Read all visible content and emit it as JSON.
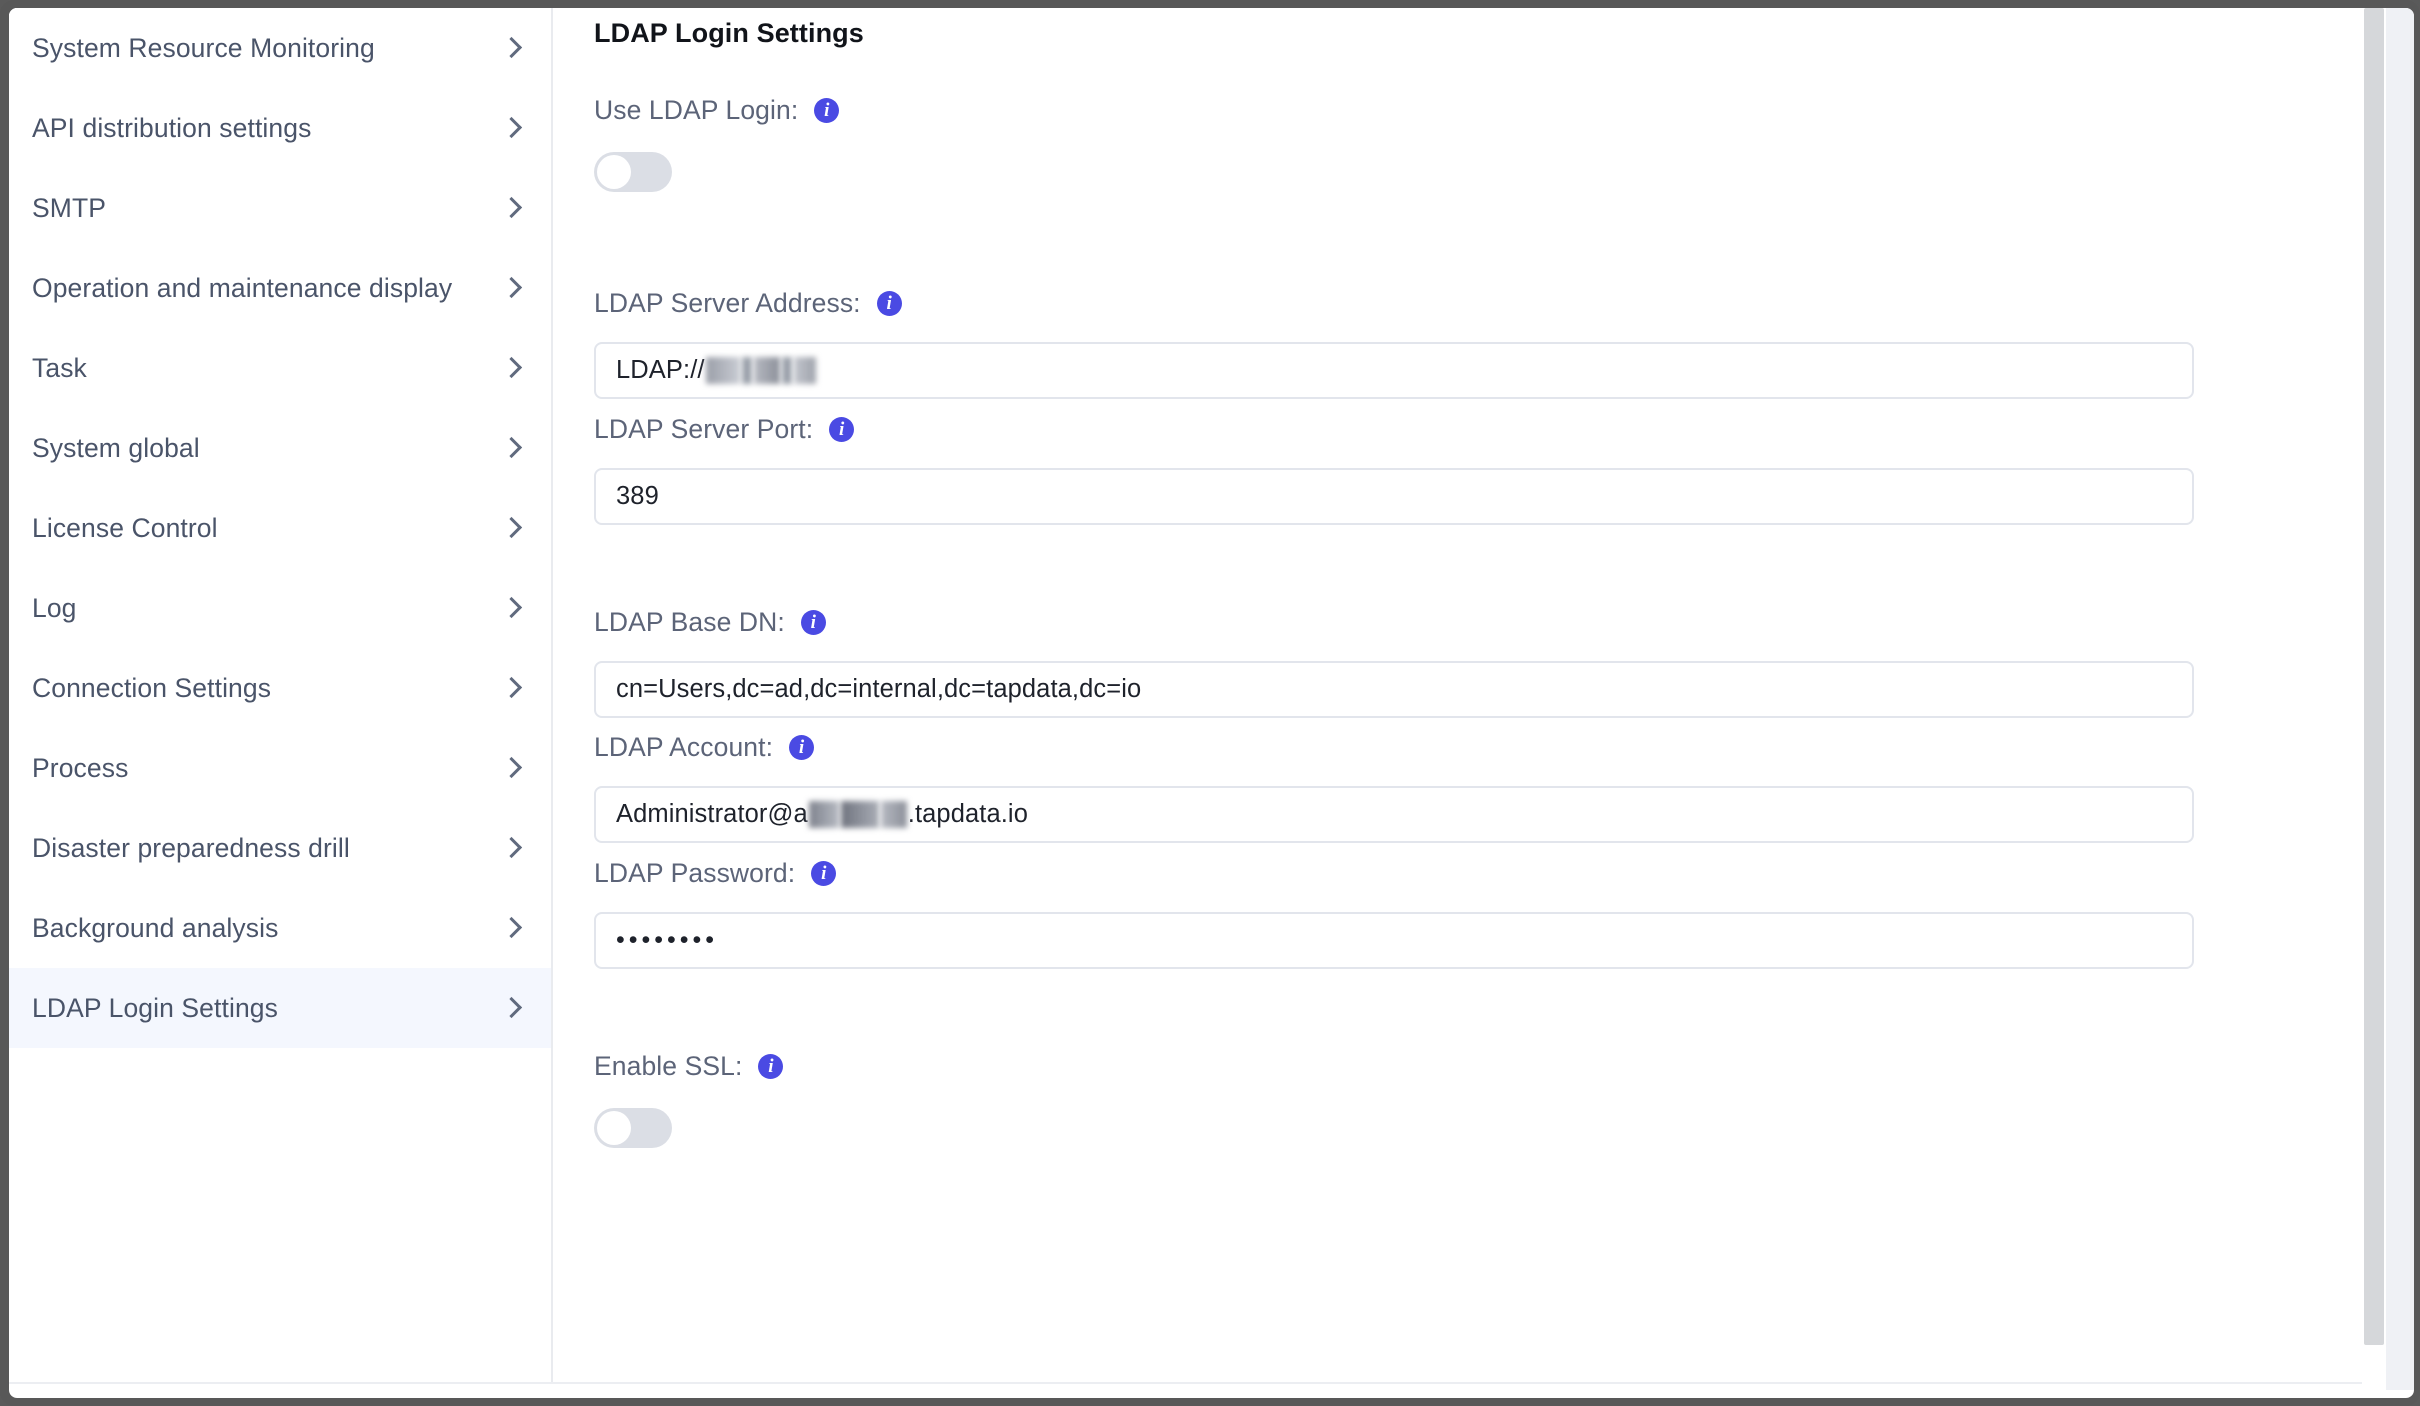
{
  "sidebar": {
    "items": [
      {
        "label": "System Resource Monitoring",
        "selected": false
      },
      {
        "label": "API distribution settings",
        "selected": false
      },
      {
        "label": "SMTP",
        "selected": false
      },
      {
        "label": "Operation and maintenance display",
        "selected": false
      },
      {
        "label": "Task",
        "selected": false
      },
      {
        "label": "System global",
        "selected": false
      },
      {
        "label": "License Control",
        "selected": false
      },
      {
        "label": "Log",
        "selected": false
      },
      {
        "label": "Connection Settings",
        "selected": false
      },
      {
        "label": "Process",
        "selected": false
      },
      {
        "label": "Disaster preparedness drill",
        "selected": false
      },
      {
        "label": "Background analysis",
        "selected": false
      },
      {
        "label": "LDAP Login Settings",
        "selected": true
      }
    ]
  },
  "panel": {
    "title": "LDAP Login Settings",
    "info_icon_glyph": "i",
    "fields": {
      "use_ldap_login": {
        "label": "Use LDAP Login:",
        "type": "toggle",
        "value": "off"
      },
      "server_address": {
        "label": "LDAP Server Address:",
        "type": "text",
        "value_prefix": "LDAP://",
        "value_redacted": true
      },
      "server_port": {
        "label": "LDAP Server Port:",
        "type": "text",
        "value": "389"
      },
      "base_dn": {
        "label": "LDAP Base DN:",
        "type": "text",
        "value": "cn=Users,dc=ad,dc=internal,dc=tapdata,dc=io"
      },
      "account": {
        "label": "LDAP Account:",
        "type": "text",
        "value_prefix": "Administrator@a",
        "value_suffix": ".tapdata.io",
        "value_redacted": true
      },
      "password": {
        "label": "LDAP Password:",
        "type": "password",
        "value": "••••••••"
      },
      "enable_ssl": {
        "label": "Enable SSL:",
        "type": "toggle",
        "value": "off"
      }
    }
  },
  "colors": {
    "accent_blue": "#4a4ae3",
    "selected_row": "#f4f7fe",
    "label_text": "#5c6478",
    "input_border": "#e2e5ec",
    "toggle_off": "#dbdee5",
    "window_chrome": "#585858"
  }
}
